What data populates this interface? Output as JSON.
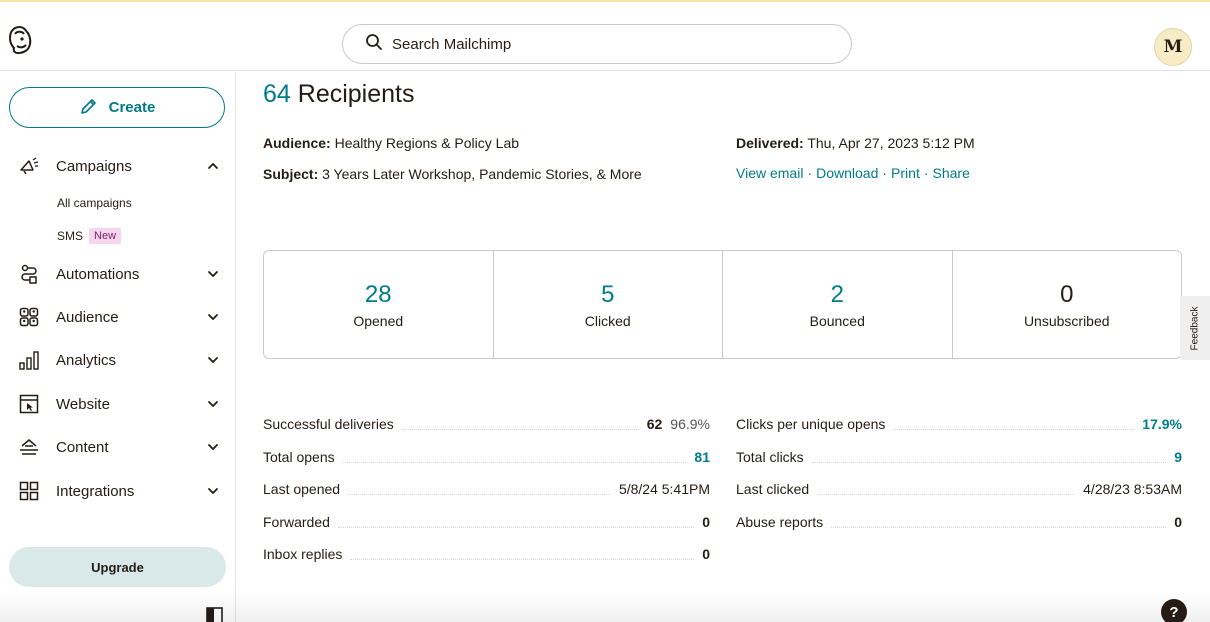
{
  "header": {
    "search_placeholder": "Search Mailchimp",
    "avatar_initial": "M"
  },
  "sidebar": {
    "create_label": "Create",
    "items": [
      {
        "label": "Campaigns",
        "icon": "megaphone-icon",
        "expanded": true
      },
      {
        "label": "Automations",
        "icon": "automations-icon",
        "expanded": false
      },
      {
        "label": "Audience",
        "icon": "audience-icon",
        "expanded": false
      },
      {
        "label": "Analytics",
        "icon": "analytics-icon",
        "expanded": false
      },
      {
        "label": "Website",
        "icon": "website-icon",
        "expanded": false
      },
      {
        "label": "Content",
        "icon": "content-icon",
        "expanded": false
      },
      {
        "label": "Integrations",
        "icon": "integrations-icon",
        "expanded": false
      }
    ],
    "subitems": {
      "all_campaigns": "All campaigns",
      "sms": "SMS",
      "sms_badge": "New"
    },
    "upgrade_label": "Upgrade"
  },
  "report": {
    "recipients_count": "64",
    "recipients_label": "Recipients",
    "audience_label": "Audience:",
    "audience_value": "Healthy Regions & Policy Lab",
    "subject_label": "Subject:",
    "subject_value": "3 Years Later Workshop, Pandemic Stories, & More",
    "delivered_label": "Delivered:",
    "delivered_value": "Thu, Apr 27, 2023 5:12 PM",
    "links": [
      "View email",
      "Download",
      "Print",
      "Share"
    ],
    "link_separator": "·"
  },
  "stats": [
    {
      "value": "28",
      "label": "Opened"
    },
    {
      "value": "5",
      "label": "Clicked"
    },
    {
      "value": "2",
      "label": "Bounced"
    },
    {
      "value": "0",
      "label": "Unsubscribed"
    }
  ],
  "feedback_label": "Feedback",
  "details_left": [
    {
      "label": "Successful deliveries",
      "value": "62",
      "pct": "96.9%"
    },
    {
      "label": "Total opens",
      "value": "81"
    },
    {
      "label": "Last opened",
      "value": "5/8/24 5:41PM"
    },
    {
      "label": "Forwarded",
      "value": "0"
    },
    {
      "label": "Inbox replies",
      "value": "0"
    }
  ],
  "details_right": [
    {
      "label": "Clicks per unique opens",
      "value": "17.9%"
    },
    {
      "label": "Total clicks",
      "value": "9"
    },
    {
      "label": "Last clicked",
      "value": "4/28/23 8:53AM"
    },
    {
      "label": "Abuse reports",
      "value": "0"
    }
  ],
  "help_label": "?",
  "colors": {
    "accent": "#007c89",
    "upgrade_bg": "#d9e9ea",
    "badge_bg": "#f6d6ef"
  }
}
